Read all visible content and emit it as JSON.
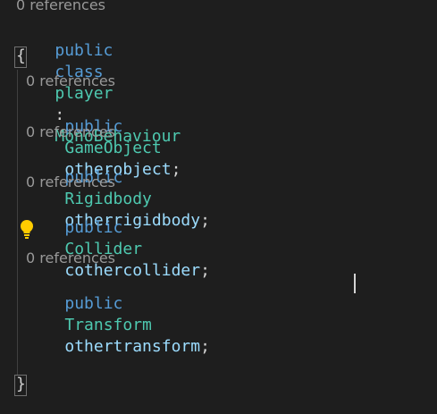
{
  "class_lens": "0 references",
  "class_decl": {
    "kw_public": "public",
    "kw_class": "class",
    "name": "player",
    "colon": ":",
    "base": "MonoBehaviour"
  },
  "open_brace": "{",
  "close_brace": "}",
  "members": [
    {
      "lens": "0 references",
      "kw": "public",
      "type": "GameObject",
      "name": "otherobject",
      "semi": ";"
    },
    {
      "lens": "0 references",
      "kw": "public",
      "type": "Rigidbody",
      "name": "otherrigidbody",
      "semi": ";"
    },
    {
      "lens": "0 references",
      "kw": "public",
      "type": "Collider",
      "name": "cothercollider",
      "semi": ";"
    },
    {
      "lens": "0 references",
      "kw": "public",
      "type": "Transform",
      "name": "othertransform",
      "semi": ";"
    }
  ],
  "icons": {
    "lightbulb": "lightbulb-icon"
  },
  "colors": {
    "background": "#1e1e1e",
    "keyword": "#569cd6",
    "type": "#4ec9b0",
    "identifier": "#9cdcfe",
    "codelens": "#999999",
    "lightbulb": "#ffcc00"
  }
}
